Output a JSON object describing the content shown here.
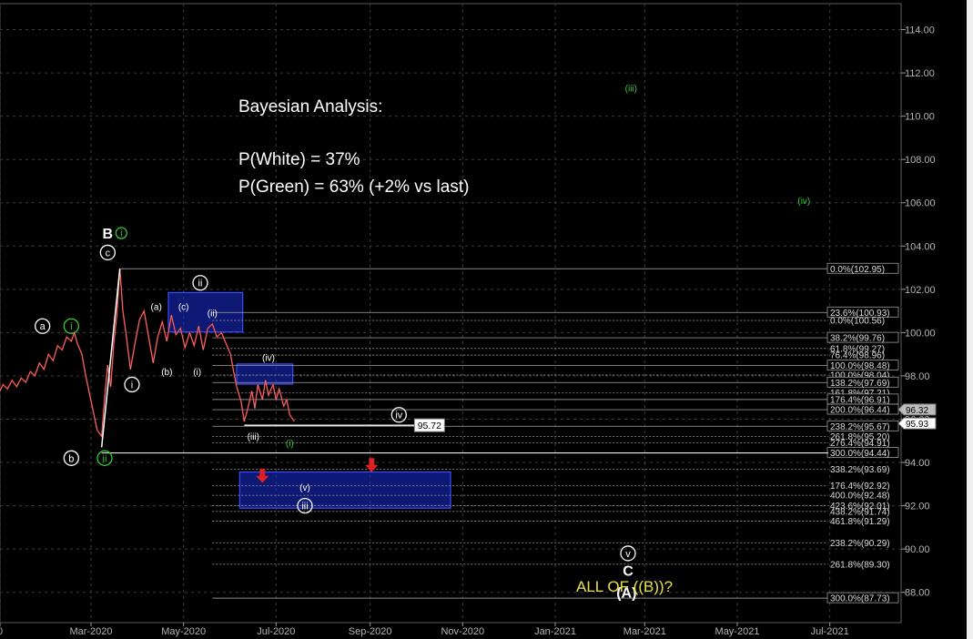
{
  "annotations": {
    "title": "Bayesian Analysis:",
    "p_white": "P(White) = 37%",
    "p_green": "P(Green) = 63% (+2% vs last)",
    "all_of_b": "ALL OF ((B))?"
  },
  "colors": {
    "background": "#000000",
    "price_line": "#c82828",
    "white_count": "#ffffff",
    "green_count": "#33cc33",
    "target_box": "#1a2bd6",
    "fib_line": "#8c8c8c",
    "arrow": "#e02020",
    "label_yellow": "#e6e14a"
  },
  "chart_data": {
    "type": "line",
    "title": "",
    "xlabel": "",
    "ylabel": "",
    "ylim": [
      86.6,
      115.2
    ],
    "xlim": [
      "2020-01-01",
      "2021-08-17"
    ],
    "x_ticks": [
      {
        "label": "0",
        "x": "2020-01-01"
      },
      {
        "label": "Mar-2020",
        "x": "2020-03-01"
      },
      {
        "label": "May-2020",
        "x": "2020-05-01"
      },
      {
        "label": "Jul-2020",
        "x": "2020-07-01"
      },
      {
        "label": "Sep-2020",
        "x": "2020-09-01"
      },
      {
        "label": "Nov-2020",
        "x": "2020-11-01"
      },
      {
        "label": "Jan-2021",
        "x": "2021-01-01"
      },
      {
        "label": "Mar-2021",
        "x": "2021-03-01"
      },
      {
        "label": "May-2021",
        "x": "2021-05-01"
      },
      {
        "label": "Jul-2021",
        "x": "2021-07-01"
      }
    ],
    "y_ticks": [
      "88.00",
      "90.00",
      "92.00",
      "94.00",
      "96.00",
      "98.00",
      "100.00",
      "102.00",
      "104.00",
      "106.00",
      "108.00",
      "110.00",
      "112.00",
      "114.00"
    ],
    "grid": true,
    "series": [
      {
        "points": [
          [
            "2020-01-01",
            97.3
          ],
          [
            "2020-01-03",
            97.6
          ],
          [
            "2020-01-06",
            97.4
          ],
          [
            "2020-01-09",
            97.8
          ],
          [
            "2020-01-12",
            97.5
          ],
          [
            "2020-01-15",
            97.9
          ],
          [
            "2020-01-18",
            97.7
          ],
          [
            "2020-01-21",
            98.2
          ],
          [
            "2020-01-24",
            98.0
          ],
          [
            "2020-01-27",
            98.6
          ],
          [
            "2020-01-30",
            98.3
          ],
          [
            "2020-02-02",
            99.0
          ],
          [
            "2020-02-05",
            98.7
          ],
          [
            "2020-02-08",
            99.4
          ],
          [
            "2020-02-11",
            99.2
          ],
          [
            "2020-02-14",
            99.8
          ],
          [
            "2020-02-17",
            99.6
          ],
          [
            "2020-02-19",
            100.0
          ],
          [
            "2020-02-21",
            99.5
          ],
          [
            "2020-02-24",
            99.0
          ],
          [
            "2020-02-26",
            98.2
          ],
          [
            "2020-02-28",
            97.5
          ],
          [
            "2020-03-02",
            96.5
          ],
          [
            "2020-03-05",
            95.5
          ],
          [
            "2020-03-08",
            95.2
          ],
          [
            "2020-03-10",
            97.0
          ],
          [
            "2020-03-12",
            98.5
          ],
          [
            "2020-03-14",
            97.5
          ],
          [
            "2020-03-16",
            99.5
          ],
          [
            "2020-03-18",
            100.8
          ],
          [
            "2020-03-20",
            102.95
          ],
          [
            "2020-03-22",
            101.0
          ],
          [
            "2020-03-24",
            100.0
          ],
          [
            "2020-03-27",
            98.3
          ],
          [
            "2020-03-30",
            99.5
          ],
          [
            "2020-04-02",
            100.6
          ],
          [
            "2020-04-05",
            101.0
          ],
          [
            "2020-04-08",
            99.8
          ],
          [
            "2020-04-11",
            98.6
          ],
          [
            "2020-04-14",
            99.8
          ],
          [
            "2020-04-17",
            100.5
          ],
          [
            "2020-04-20",
            99.6
          ],
          [
            "2020-04-23",
            100.8
          ],
          [
            "2020-04-26",
            99.9
          ],
          [
            "2020-04-29",
            100.2
          ],
          [
            "2020-05-02",
            99.3
          ],
          [
            "2020-05-05",
            100.0
          ],
          [
            "2020-05-08",
            99.4
          ],
          [
            "2020-05-11",
            100.3
          ],
          [
            "2020-05-14",
            99.2
          ],
          [
            "2020-05-17",
            100.2
          ],
          [
            "2020-05-20",
            100.4
          ],
          [
            "2020-05-23",
            99.8
          ],
          [
            "2020-05-26",
            100.0
          ],
          [
            "2020-05-29",
            99.5
          ],
          [
            "2020-06-01",
            99.0
          ],
          [
            "2020-06-03",
            98.2
          ],
          [
            "2020-06-05",
            97.5
          ],
          [
            "2020-06-08",
            96.8
          ],
          [
            "2020-06-10",
            95.9
          ],
          [
            "2020-06-12",
            96.4
          ],
          [
            "2020-06-15",
            97.3
          ],
          [
            "2020-06-17",
            96.5
          ],
          [
            "2020-06-19",
            97.6
          ],
          [
            "2020-06-22",
            96.9
          ],
          [
            "2020-06-24",
            97.8
          ],
          [
            "2020-06-26",
            97.1
          ],
          [
            "2020-06-29",
            97.6
          ],
          [
            "2020-07-01",
            96.9
          ],
          [
            "2020-07-03",
            97.4
          ],
          [
            "2020-07-06",
            96.6
          ],
          [
            "2020-07-08",
            96.9
          ],
          [
            "2020-07-10",
            96.2
          ],
          [
            "2020-07-13",
            95.9
          ]
        ]
      }
    ],
    "fib_levels": [
      {
        "label": "0.0%(102.95)",
        "y": 102.95,
        "from": "2020-03-20",
        "boxed": true
      },
      {
        "label": "23.6%(100.93)",
        "y": 100.93,
        "from": "2020-05-20",
        "boxed": true
      },
      {
        "label": "0.0%(100.56)",
        "y": 100.56,
        "from": "2020-05-20",
        "boxed": false
      },
      {
        "label": "38.2%(99.76)",
        "y": 99.76,
        "from": "2020-05-20",
        "boxed": true
      },
      {
        "label": "61.8%(99.27)",
        "y": 99.27,
        "from": "2020-05-20",
        "boxed": false
      },
      {
        "label": "76.4%(98.96)",
        "y": 98.96,
        "from": "2020-05-20",
        "boxed": false
      },
      {
        "label": "100.0%(98.48)",
        "y": 98.48,
        "from": "2020-05-20",
        "boxed": true
      },
      {
        "label": "100.0%(98.04)",
        "y": 98.04,
        "from": "2020-05-20",
        "boxed": false
      },
      {
        "label": "138.2%(97.69)",
        "y": 97.69,
        "from": "2020-05-20",
        "boxed": true
      },
      {
        "label": "161.8%(97.21)",
        "y": 97.21,
        "from": "2020-05-20",
        "boxed": false
      },
      {
        "label": "176.4%(96.91)",
        "y": 96.91,
        "from": "2020-05-20",
        "boxed": true
      },
      {
        "label": "200.0%(96.44)",
        "y": 96.44,
        "from": "2020-05-20",
        "boxed": true
      },
      {
        "label": "238.2%(95.67)",
        "y": 95.67,
        "from": "2020-05-20",
        "boxed": true
      },
      {
        "label": "261.8%(95.20)",
        "y": 95.2,
        "from": "2020-05-20",
        "boxed": false
      },
      {
        "label": "276.4%(94.91)",
        "y": 94.91,
        "from": "2020-05-20",
        "boxed": false
      },
      {
        "label": "300.0%(94.44)",
        "y": 94.44,
        "from": "2020-05-20",
        "boxed": true
      },
      {
        "label": "338.2%(93.69)",
        "y": 93.69,
        "from": "2020-05-20",
        "boxed": false
      },
      {
        "label": "176.4%(92.92)",
        "y": 92.92,
        "from": "2020-05-20",
        "boxed": false
      },
      {
        "label": "400.0%(92.48)",
        "y": 92.48,
        "from": "2020-05-20",
        "boxed": false
      },
      {
        "label": "423.6%(92.01)",
        "y": 92.01,
        "from": "2020-05-20",
        "boxed": false
      },
      {
        "label": "438.2%(91.74)",
        "y": 91.74,
        "from": "2020-05-20",
        "boxed": false
      },
      {
        "label": "461.8%(91.29)",
        "y": 91.29,
        "from": "2020-05-20",
        "boxed": false
      },
      {
        "label": "238.2%(90.29)",
        "y": 90.29,
        "from": "2020-05-20",
        "boxed": false
      },
      {
        "label": "261.8%(89.30)",
        "y": 89.3,
        "from": "2020-05-20",
        "boxed": false
      },
      {
        "label": "300.0%(87.73)",
        "y": 87.73,
        "from": "2020-05-20",
        "boxed": true
      }
    ],
    "price_labels": [
      {
        "label": "96.32",
        "y": 96.32
      },
      {
        "label": "95.93",
        "y": 95.93
      }
    ],
    "level_line": {
      "label": "95.72",
      "y": 95.72,
      "from": "2020-06-10",
      "to": "2020-10-20"
    },
    "boxes": [
      {
        "from": "2020-04-21",
        "to": "2020-06-09",
        "y1": 101.85,
        "y2": 100.03
      },
      {
        "from": "2020-06-05",
        "to": "2020-07-12",
        "y1": 98.55,
        "y2": 97.62
      },
      {
        "from": "2020-06-07",
        "to": "2020-10-24",
        "y1": 93.56,
        "y2": 91.89
      }
    ],
    "arrows": [
      {
        "x": "2020-06-22",
        "y_from": 93.7,
        "y_to": 93.05
      },
      {
        "x": "2020-09-02",
        "y_from": 94.2,
        "y_to": 93.55
      }
    ],
    "wave_labels": [
      {
        "text": "B",
        "x": "2020-03-12",
        "y": 104.6,
        "color": "white",
        "circled": false,
        "size": "large"
      },
      {
        "text": "i",
        "x": "2020-03-21",
        "y": 104.6,
        "color": "green",
        "circled": true,
        "size": "small"
      },
      {
        "text": "c",
        "x": "2020-03-12",
        "y": 103.7,
        "color": "white",
        "circled": true,
        "size": "medium"
      },
      {
        "text": "ii",
        "x": "2020-05-12",
        "y": 102.3,
        "color": "white",
        "circled": true,
        "size": "medium"
      },
      {
        "text": "(a)",
        "x": "2020-04-13",
        "y": 101.2,
        "color": "white",
        "circled": false,
        "size": "small"
      },
      {
        "text": "(c)",
        "x": "2020-05-01",
        "y": 101.2,
        "color": "white",
        "circled": false,
        "size": "small"
      },
      {
        "text": "(ii)",
        "x": "2020-05-20",
        "y": 100.9,
        "color": "white",
        "circled": false,
        "size": "small"
      },
      {
        "text": "a",
        "x": "2020-01-29",
        "y": 100.3,
        "color": "white",
        "circled": true,
        "size": "medium"
      },
      {
        "text": "i",
        "x": "2020-02-17",
        "y": 100.3,
        "color": "green",
        "circled": true,
        "size": "medium"
      },
      {
        "text": "(b)",
        "x": "2020-04-20",
        "y": 98.2,
        "color": "white",
        "circled": false,
        "size": "small"
      },
      {
        "text": "(i)",
        "x": "2020-05-10",
        "y": 98.2,
        "color": "white",
        "circled": false,
        "size": "small"
      },
      {
        "text": "(iv)",
        "x": "2020-06-26",
        "y": 98.85,
        "color": "white",
        "circled": false,
        "size": "small"
      },
      {
        "text": "i",
        "x": "2020-03-28",
        "y": 97.6,
        "color": "white",
        "circled": true,
        "size": "medium"
      },
      {
        "text": "iv",
        "x": "2020-09-20",
        "y": 96.2,
        "color": "white",
        "circled": true,
        "size": "medium"
      },
      {
        "text": "(iii)",
        "x": "2020-06-16",
        "y": 95.2,
        "color": "white",
        "circled": false,
        "size": "small"
      },
      {
        "text": "(i)",
        "x": "2020-07-10",
        "y": 94.9,
        "color": "green",
        "circled": false,
        "size": "small"
      },
      {
        "text": "b",
        "x": "2020-02-17",
        "y": 94.2,
        "color": "white",
        "circled": true,
        "size": "medium"
      },
      {
        "text": "ii",
        "x": "2020-03-10",
        "y": 94.2,
        "color": "green",
        "circled": true,
        "size": "medium"
      },
      {
        "text": "(v)",
        "x": "2020-07-20",
        "y": 92.85,
        "color": "white",
        "circled": false,
        "size": "small"
      },
      {
        "text": "iii",
        "x": "2020-07-20",
        "y": 92.0,
        "color": "white",
        "circled": true,
        "size": "medium"
      },
      {
        "text": "(iii)",
        "x": "2021-02-20",
        "y": 111.3,
        "color": "green",
        "circled": false,
        "size": "small"
      },
      {
        "text": "(iv)",
        "x": "2021-06-14",
        "y": 106.1,
        "color": "green",
        "circled": false,
        "size": "small"
      },
      {
        "text": "v",
        "x": "2021-02-18",
        "y": 89.8,
        "color": "white",
        "circled": true,
        "size": "medium"
      },
      {
        "text": "C",
        "x": "2021-02-18",
        "y": 89.0,
        "color": "white",
        "circled": false,
        "size": "large"
      },
      {
        "text": "(A)",
        "x": "2021-02-17",
        "y": 88.0,
        "color": "white",
        "circled": false,
        "size": "large"
      }
    ]
  }
}
